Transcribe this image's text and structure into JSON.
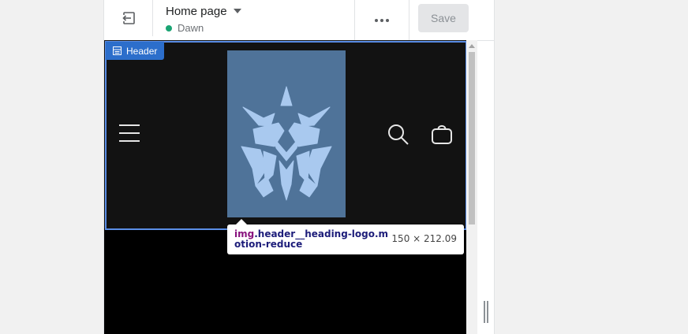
{
  "topbar": {
    "page_select_label": "Home page",
    "theme_name": "Dawn",
    "theme_status_color": "#1aa473",
    "save_label": "Save",
    "save_bg": "#e4e5e7",
    "save_color": "#8c9196",
    "icons": {
      "exit": "exit-icon",
      "dropdown": "caret-down-icon",
      "more": "ellipsis-icon"
    }
  },
  "preview": {
    "section_tag": {
      "label": "Header",
      "color": "#2c6ecb",
      "icon": "section-icon"
    },
    "header": {
      "background": "#121212",
      "logo_background": "#4f7399",
      "logo_color": "#a9c9ef",
      "icons": {
        "menu": "hamburger-menu-icon",
        "search": "search-icon",
        "cart": "cart-icon"
      }
    },
    "tooltip": {
      "tag": "img",
      "selector": ".header__heading-logo.motion-reduce",
      "dimensions": "150 × 212.09"
    }
  }
}
